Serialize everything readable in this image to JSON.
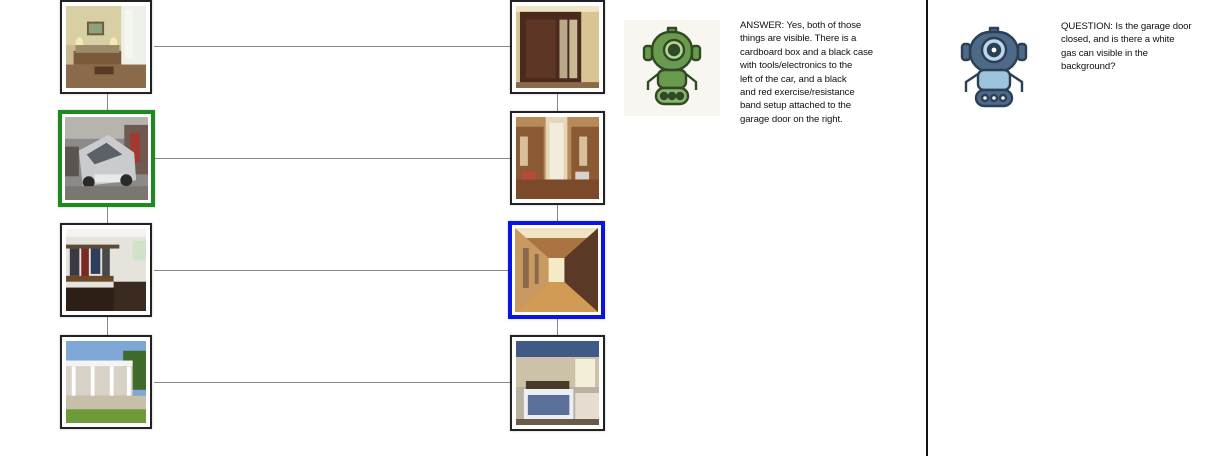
{
  "answer": {
    "prefix": "ANSWER:",
    "lines": [
      "Yes, both of those",
      "things are visible. There is a",
      "cardboard box and a black case",
      "with tools/electronics to the",
      "left of the car, and a black",
      "and red exercise/resistance",
      "band setup attached to the",
      "garage door on the right."
    ]
  },
  "question": {
    "lines": [
      "QUESTION: Is the garage door",
      "closed, and is there a white",
      "gas can visible in the",
      "background?"
    ]
  },
  "graph": {
    "left_column": [
      "living-room",
      "garage-car",
      "mudroom",
      "pergola-patio"
    ],
    "right_column": [
      "front-door",
      "closet-hallway",
      "long-hallway",
      "bedroom"
    ],
    "selected_left": "garage-car",
    "selected_right": "long-hallway"
  },
  "colors": {
    "selected_left_border": "#1d8a1d",
    "selected_right_border": "#0a16e0",
    "answer_bot": "#6a9a4e",
    "question_bot": "#3d5670"
  }
}
